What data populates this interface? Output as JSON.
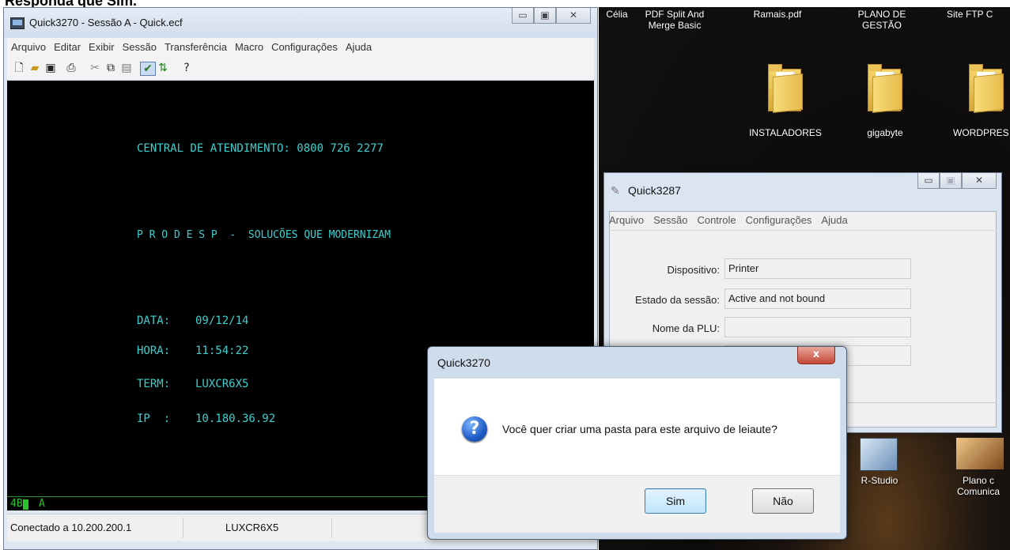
{
  "heading": "Responda que Sim.",
  "desktop": {
    "top_labels": [
      "Célia",
      "PDF Split And Merge Basic",
      "Ramais.pdf",
      "PLANO DE GESTÃO",
      "Site FTP C"
    ],
    "folders": [
      "INSTALADORES",
      "gigabyte",
      "WORDPRES"
    ],
    "bottom_labels": [
      "R-Studio",
      "Plano c Comunica"
    ]
  },
  "main_window": {
    "title": "Quick3270 - Sessão A - Quick.ecf",
    "menu": [
      "Arquivo",
      "Editar",
      "Exibir",
      "Sessão",
      "Transferência",
      "Macro",
      "Configurações",
      "Ajuda"
    ],
    "toolbar_icons": [
      "new-icon",
      "open-icon",
      "save-icon",
      "print-icon",
      "cut-icon",
      "copy-icon",
      "paste-icon",
      "macro-icon",
      "transfer-icon",
      "help-icon"
    ],
    "terminal": {
      "central": "CENTRAL DE ATENDIMENTO: 0800 726 2277",
      "prodesp": "P R O D E S P  -  SOLUCÕES QUE MODERNIZAM",
      "data_label": "DATA:",
      "data_value": "09/12/14",
      "hora_label": "HORA:",
      "hora_value": "11:54:22",
      "term_label": "TERM:",
      "term_value": "LUXCR6X5",
      "ip_label": "IP  :",
      "ip_value": "10.180.36.92"
    },
    "oia_left": "4B",
    "oia_mode": "A",
    "status_connection": "Conectado a 10.200.200.1",
    "status_term": "LUXCR6X5"
  },
  "win_3287": {
    "title": "Quick3287",
    "menu": [
      "Arquivo",
      "Sessão",
      "Controle",
      "Configurações",
      "Ajuda"
    ],
    "fields": [
      {
        "label": "Dispositivo:",
        "value": "Printer"
      },
      {
        "label": "Estado da sessão:",
        "value": "Active and not bound"
      },
      {
        "label": "Nome da PLU:",
        "value": ""
      }
    ]
  },
  "dialog": {
    "title": "Quick3270",
    "close": "x",
    "message": "Você quer criar uma pasta para este arquivo de leiaute?",
    "yes": "Sim",
    "no": "Não"
  },
  "colors": {
    "terminal_text": "#3bd0d0",
    "oia_text": "#29c429",
    "terminal_bg": "#000000"
  }
}
